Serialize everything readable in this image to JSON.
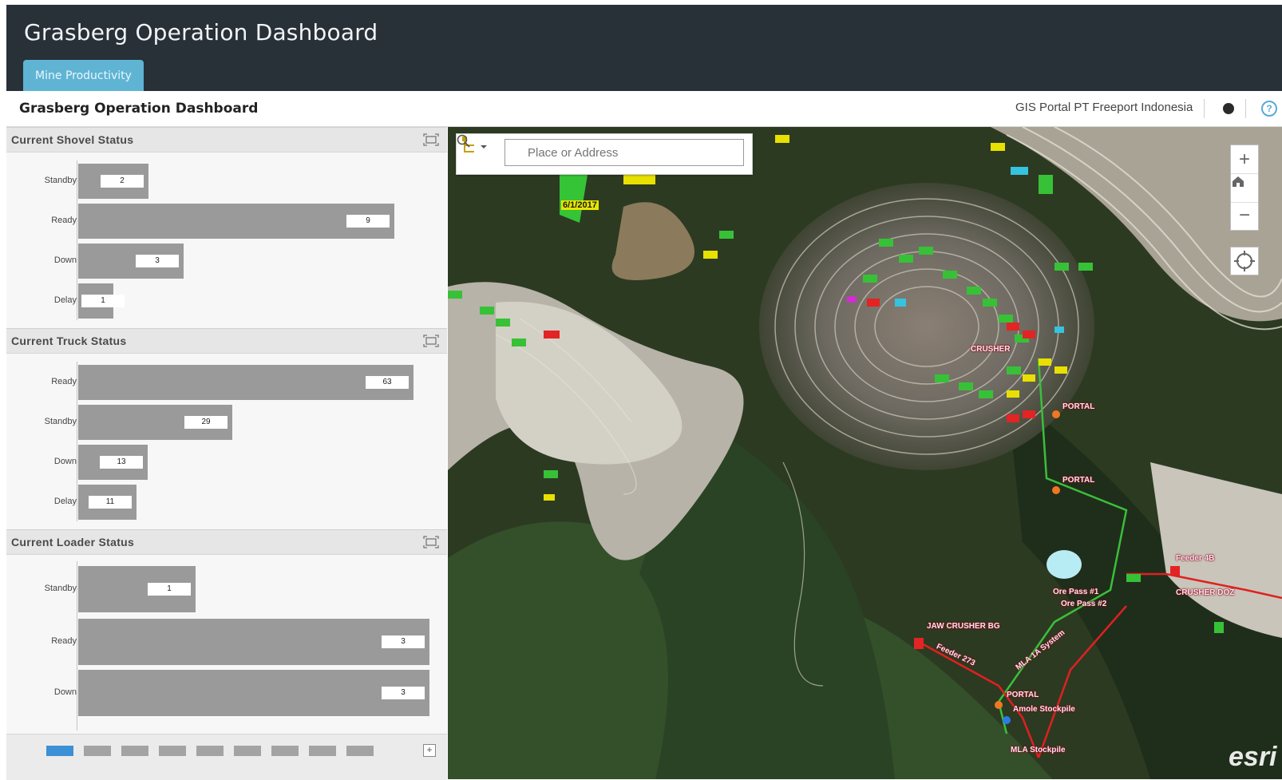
{
  "app": {
    "title": "Grasberg Operation Dashboard",
    "tab": "Mine Productivity"
  },
  "header": {
    "page_title": "Grasberg Operation Dashboard",
    "portal": "GIS Portal PT Freeport Indonesia"
  },
  "panels": [
    {
      "title": "Current Shovel Status",
      "max": 10,
      "rows": [
        {
          "label": "Standby",
          "value": 2
        },
        {
          "label": "Ready",
          "value": 9
        },
        {
          "label": "Down",
          "value": 3
        },
        {
          "label": "Delay",
          "value": 1
        }
      ]
    },
    {
      "title": "Current Truck Status",
      "max": 66,
      "rows": [
        {
          "label": "Ready",
          "value": 63
        },
        {
          "label": "Standby",
          "value": 29
        },
        {
          "label": "Down",
          "value": 13
        },
        {
          "label": "Delay",
          "value": 11
        }
      ]
    },
    {
      "title": "Current Loader Status",
      "max": 3,
      "rows": [
        {
          "label": "Standby",
          "value": 1
        },
        {
          "label": "Ready",
          "value": 3
        },
        {
          "label": "Down",
          "value": 3
        }
      ]
    }
  ],
  "pager": {
    "active_page": 1,
    "page_count": 9
  },
  "map": {
    "search_placeholder": "Place or Address",
    "date_label": "6/1/2017",
    "attribution": "esri",
    "labels": {
      "crusher": "CRUSHER",
      "portal_1": "PORTAL",
      "portal_2": "PORTAL",
      "portal_3": "PORTAL",
      "jaw_crusher": "JAW CRUSHER BG",
      "feeder": "Feeder 273",
      "ore_pass_1": "Ore Pass #1",
      "ore_pass_2": "Ore Pass #2",
      "crusher_right": "CRUSHER DOZ",
      "mla_system": "MLA 1A System",
      "mla_stockpile": "MLA Stockpile",
      "amole_stockpile": "Amole Stockpile",
      "feeder_right": "Feeder 4B"
    }
  },
  "colors": {
    "topbar": "#283038",
    "tab": "#5fb4d4",
    "bar": "#9a9a9a",
    "pager_active": "#3d8fd6",
    "route_green": "#3bbf3b",
    "route_red": "#e02020"
  }
}
